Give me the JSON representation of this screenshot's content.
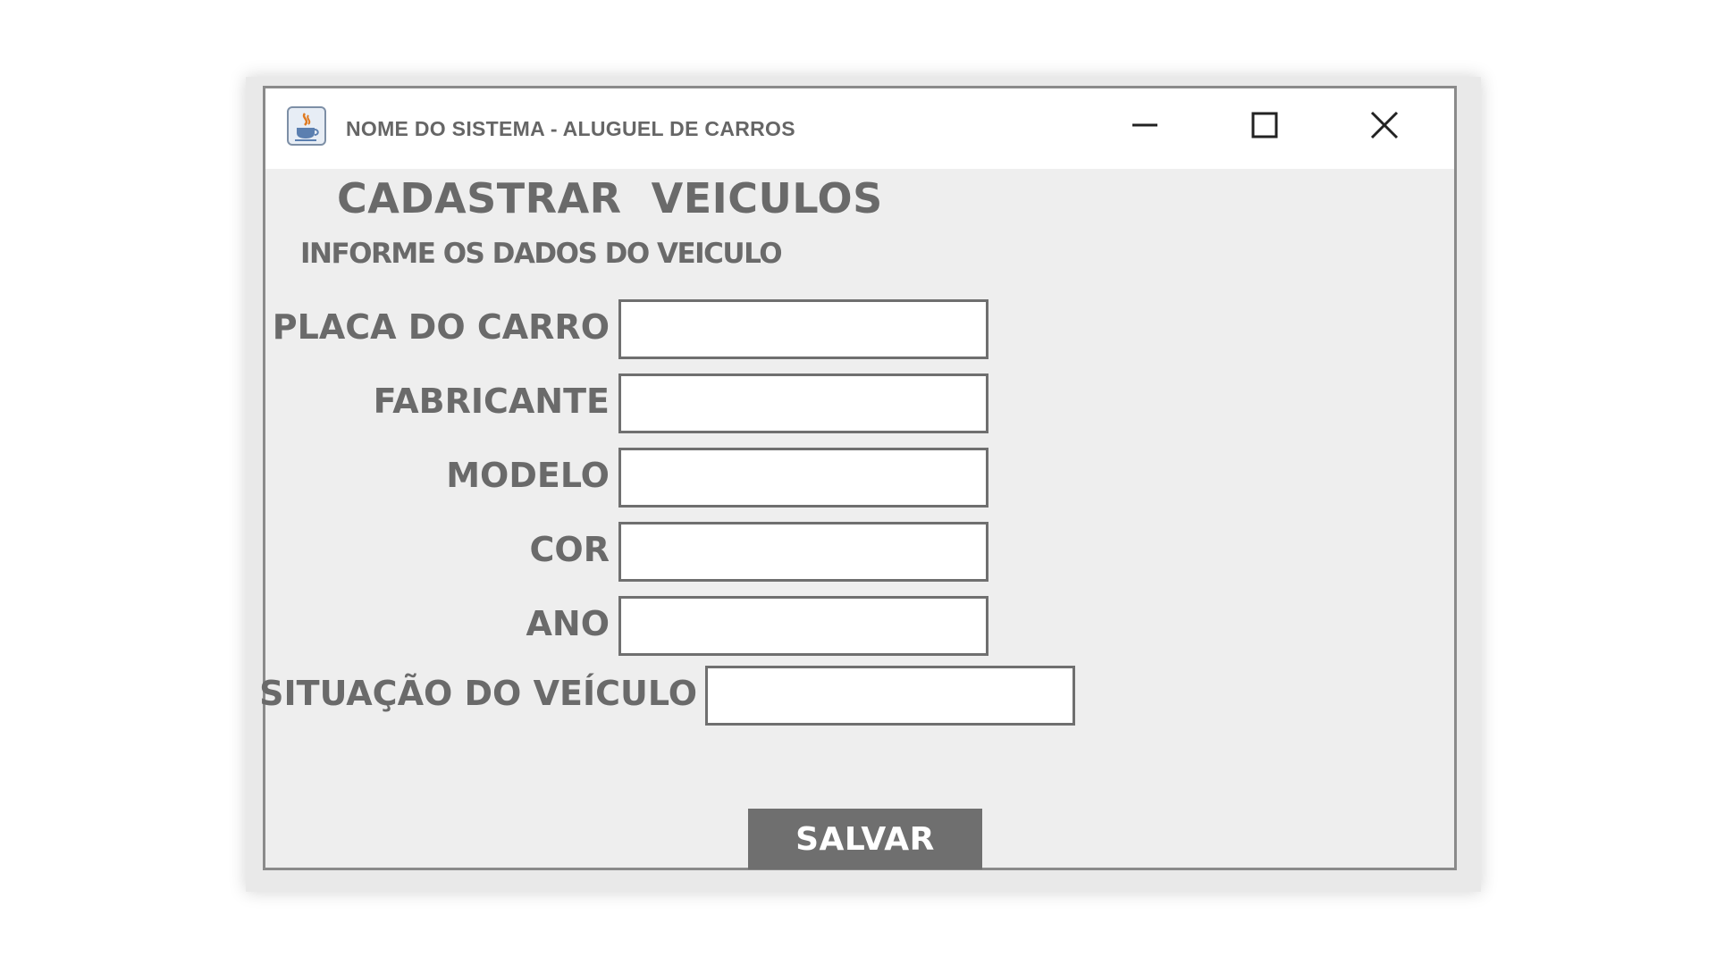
{
  "window": {
    "title": "NOME DO SISTEMA - ALUGUEL DE CARROS",
    "icon": "java-cup-icon",
    "controls": [
      "minimize-icon",
      "maximize-icon",
      "close-icon"
    ]
  },
  "form": {
    "heading": "CADASTRAR  VEICULOS",
    "subheading": "INFORME OS DADOS DO VEICULO",
    "fields": [
      {
        "label": "PLACA DO CARRO",
        "value": "",
        "placeholder": ""
      },
      {
        "label": "FABRICANTE",
        "value": "",
        "placeholder": ""
      },
      {
        "label": "MODELO",
        "value": "",
        "placeholder": ""
      },
      {
        "label": "COR",
        "value": "",
        "placeholder": ""
      },
      {
        "label": "ANO",
        "value": "",
        "placeholder": ""
      },
      {
        "label": "SITUAÇÃO DO VEÍCULO",
        "value": "",
        "placeholder": ""
      }
    ],
    "save_label": "SALVAR"
  },
  "colors": {
    "window_bg": "#eeeeee",
    "titlebar_bg": "#ffffff",
    "text": "#6a6a6a",
    "button_bg": "#6f6f6f",
    "button_text": "#ffffff",
    "field_border": "#6f6f6f"
  }
}
